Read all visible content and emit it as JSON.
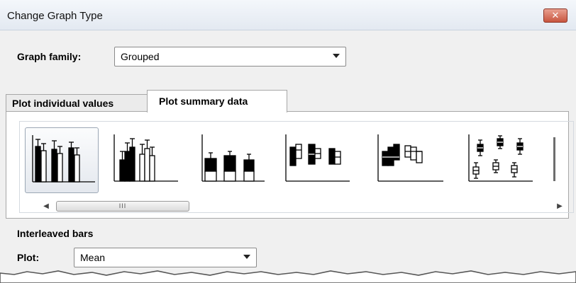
{
  "window": {
    "title": "Change Graph Type",
    "close_glyph": "✕"
  },
  "graph_family": {
    "label": "Graph family:",
    "value": "Grouped"
  },
  "tabs": [
    {
      "label": "Plot individual values",
      "active": false
    },
    {
      "label": "Plot summary data",
      "active": true
    }
  ],
  "gallery": {
    "icons": [
      "interleaved-bars-icon",
      "grouped-bars-icon",
      "stacked-bars-icon",
      "floating-bars-icon",
      "floating-bars-2-icon",
      "box-plot-icon"
    ],
    "selected_index": 0,
    "scroll_grip": "III"
  },
  "selection_label": "Interleaved bars",
  "plot": {
    "label": "Plot:",
    "value": "Mean"
  },
  "colors": {
    "title_bar": "#e6ecf3",
    "close_button": "#c8553f",
    "selection": "#e4e8ee"
  }
}
